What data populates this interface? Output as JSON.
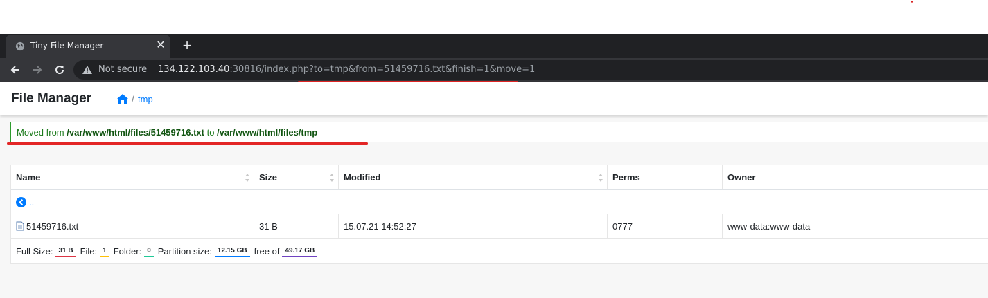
{
  "browser": {
    "tab_title": "Tiny File Manager",
    "security_label": "Not secure",
    "url_host": "134.122.103.40",
    "url_rest": ":30816/index.php?to=tmp&from=51459716.txt&finish=1&move=1"
  },
  "header": {
    "title": "File Manager",
    "breadcrumb_sep": "/",
    "breadcrumb_current": "tmp"
  },
  "alert": {
    "prefix": "Moved from ",
    "from_path": "/var/www/html/files/51459716.txt",
    "middle": " to ",
    "to_path": "/var/www/html/files/tmp"
  },
  "table": {
    "columns": [
      "Name",
      "Size",
      "Modified",
      "Perms",
      "Owner"
    ],
    "parent_link": "..",
    "rows": [
      {
        "name": "51459716.txt",
        "size": "31 B",
        "modified": "15.07.21 14:52:27",
        "perms": "0777",
        "owner": "www-data:www-data"
      }
    ]
  },
  "footer": {
    "full_size_label": "Full Size:",
    "full_size_value": "31 B",
    "file_label": "File:",
    "file_value": "1",
    "folder_label": "Folder:",
    "folder_value": "0",
    "partition_label": "Partition size:",
    "partition_value": "12.15 GB",
    "free_label": "free of",
    "free_value": "49.17 GB"
  },
  "colors": {
    "annotation_red": "#e32626",
    "alert_green": "#2e9c2e",
    "link_blue": "#007bff",
    "badge_red": "#dc3545",
    "badge_yellow": "#ffc107",
    "badge_teal": "#20c997",
    "badge_blue": "#007bff",
    "badge_purple": "#6f42c1"
  }
}
